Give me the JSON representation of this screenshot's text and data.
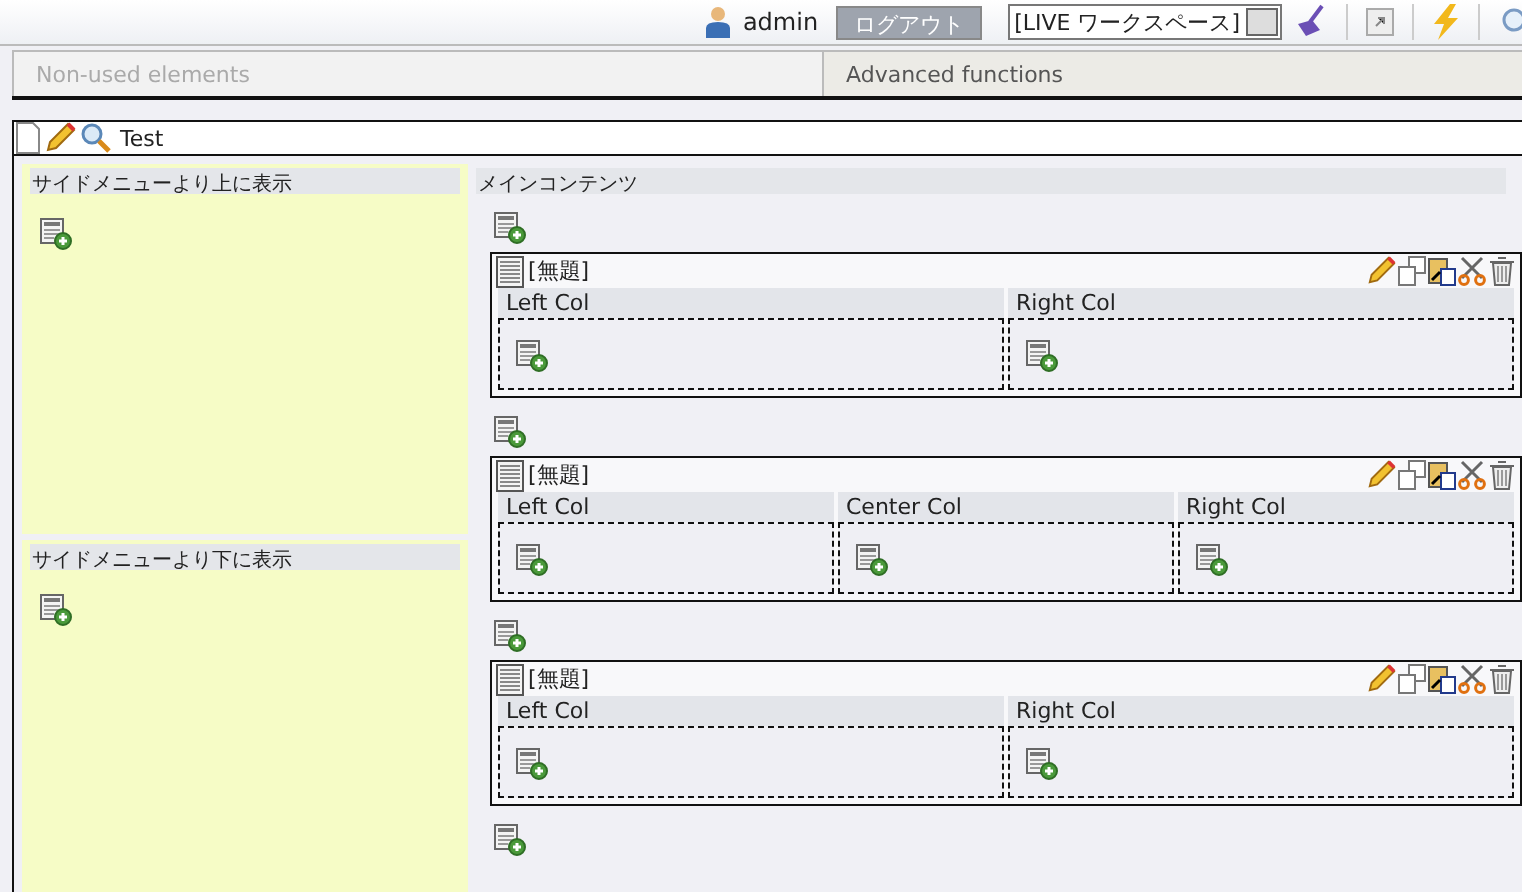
{
  "header": {
    "user": "admin",
    "logout": "ログアウト",
    "workspace": "[LIVE ワークスペース]"
  },
  "tabs": [
    {
      "label": "Non-used elements",
      "disabled": true
    },
    {
      "label": "Advanced functions",
      "disabled": false
    }
  ],
  "page": {
    "title": "Test"
  },
  "side_areas": [
    {
      "title": "サイドメニューより上に表示"
    },
    {
      "title": "サイドメニューより下に表示"
    }
  ],
  "main": {
    "title": "メインコンテンツ",
    "blocks": [
      {
        "title": "[無題]",
        "columns": [
          "Left Col",
          "Right Col"
        ]
      },
      {
        "title": "[無題]",
        "columns": [
          "Left Col",
          "Center Col",
          "Right Col"
        ]
      },
      {
        "title": "[無題]",
        "columns": [
          "Left Col",
          "Right Col"
        ]
      }
    ]
  }
}
